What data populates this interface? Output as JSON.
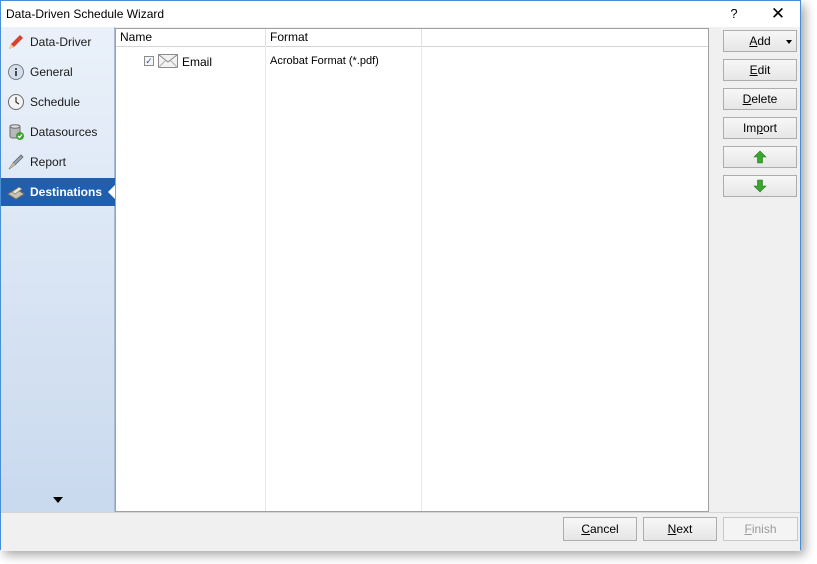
{
  "window": {
    "title": "Data-Driven Schedule Wizard",
    "help_label": "?",
    "close_label": "✕"
  },
  "sidebar": {
    "items": [
      {
        "label": "Data-Driver",
        "icon": "pencil-icon"
      },
      {
        "label": "General",
        "icon": "info-icon"
      },
      {
        "label": "Schedule",
        "icon": "clock-icon"
      },
      {
        "label": "Datasources",
        "icon": "database-icon"
      },
      {
        "label": "Report",
        "icon": "report-icon"
      },
      {
        "label": "Destinations",
        "icon": "destination-icon",
        "active": true
      }
    ]
  },
  "list": {
    "columns": [
      "Name",
      "Format"
    ],
    "rows": [
      {
        "checked": true,
        "name": "Email",
        "format": "Acrobat Format (*.pdf)"
      }
    ]
  },
  "actions": {
    "add": {
      "pre": "",
      "u": "A",
      "post": "dd"
    },
    "edit": {
      "pre": "",
      "u": "E",
      "post": "dit"
    },
    "delete": {
      "pre": "",
      "u": "D",
      "post": "elete"
    },
    "import": {
      "pre": "Im",
      "u": "p",
      "post": "ort"
    },
    "move_up_icon": "green-up-arrow-icon",
    "move_down_icon": "green-down-arrow-icon"
  },
  "footer": {
    "cancel": {
      "pre": "",
      "u": "C",
      "post": "ancel"
    },
    "next": {
      "pre": "",
      "u": "N",
      "post": "ext"
    },
    "finish": {
      "pre": "",
      "u": "F",
      "post": "inish"
    }
  },
  "colors": {
    "active_nav": "#1f5fae",
    "window_border": "#4a8fd6",
    "accent_green": "#3aa52f"
  }
}
